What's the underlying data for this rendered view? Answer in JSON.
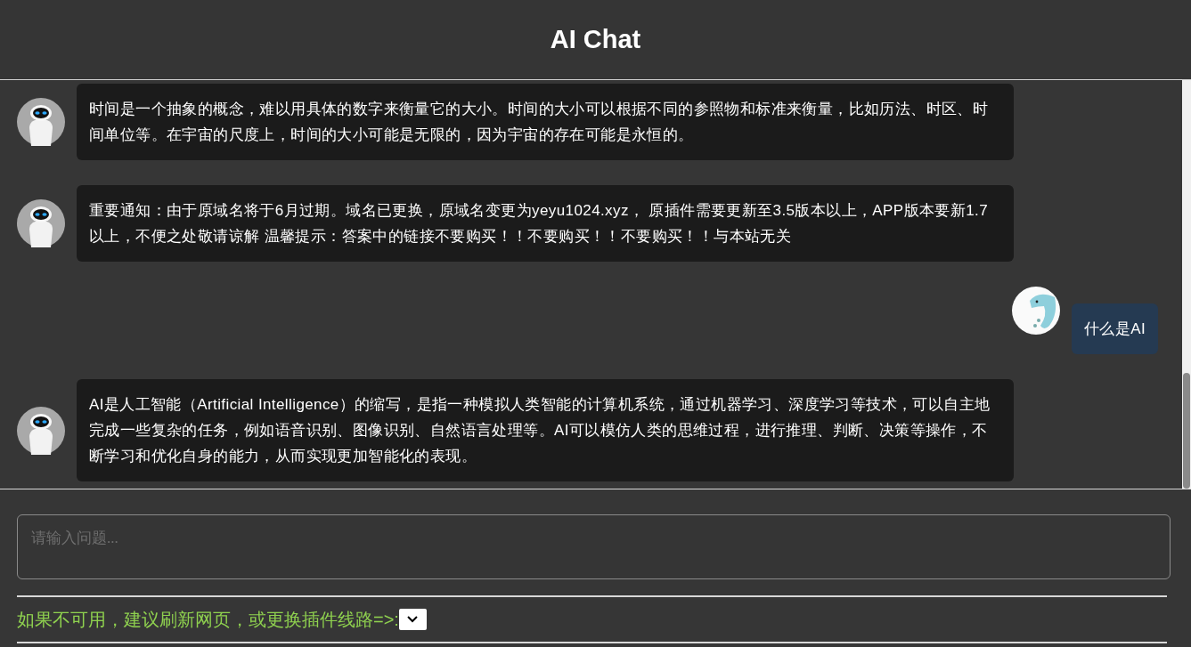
{
  "header": {
    "title": "AI Chat"
  },
  "messages": [
    {
      "kind": "bot",
      "text": "时间是一个抽象的概念，难以用具体的数字来衡量它的大小。时间的大小可以根据不同的参照物和标准来衡量，比如历法、时区、时间单位等。在宇宙的尺度上，时间的大小可能是无限的，因为宇宙的存在可能是永恒的。"
    },
    {
      "kind": "bot",
      "text": "重要通知：由于原域名将于6月过期。域名已更换，原域名变更为yeyu1024.xyz， 原插件需要更新至3.5版本以上，APP版本要新1.7以上，不便之处敬请谅解 温馨提示：答案中的链接不要购买！！不要购买！！不要购买！！与本站无关"
    },
    {
      "kind": "user",
      "text": "什么是AI"
    },
    {
      "kind": "bot",
      "text": "AI是人工智能（Artificial Intelligence）的缩写，是指一种模拟人类智能的计算机系统，通过机器学习、深度学习等技术，可以自主地完成一些复杂的任务，例如语音识别、图像识别、自然语言处理等。AI可以模仿人类的思维过程，进行推理、判断、决策等操作，不断学习和优化自身的能力，从而实现更加智能化的表现。"
    }
  ],
  "input": {
    "placeholder": "请输入问题..."
  },
  "notice": {
    "text": "如果不可用，建议刷新网页，或更换插件线路=>:"
  }
}
